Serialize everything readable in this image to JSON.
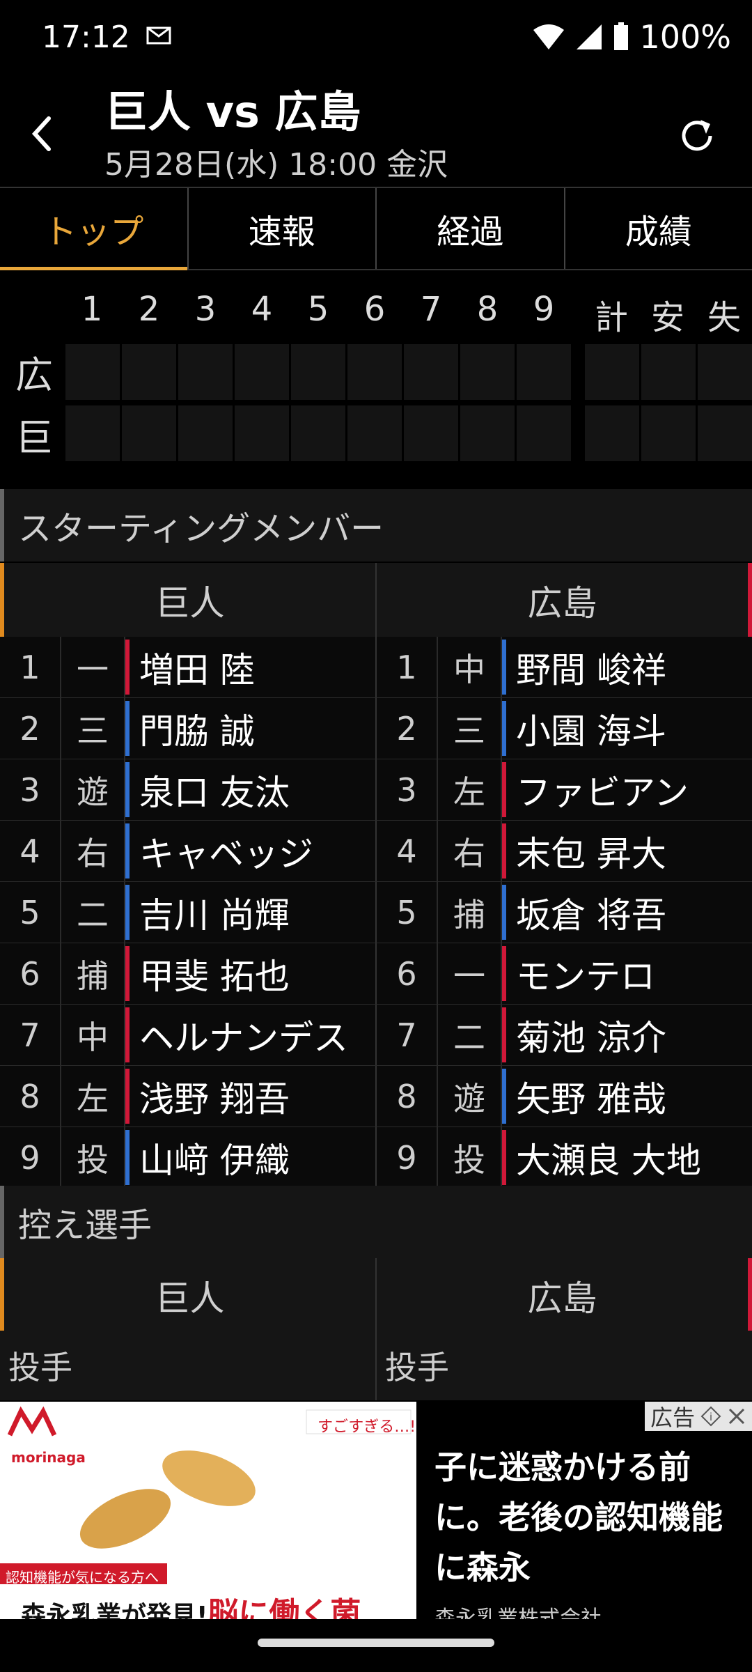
{
  "status": {
    "time": "17:12",
    "battery": "100%"
  },
  "header": {
    "title": "巨人 vs 広島",
    "subtitle": "5月28日(水) 18:00 金沢"
  },
  "tabs": [
    "トップ",
    "速報",
    "経過",
    "成績"
  ],
  "scoreboard": {
    "innings": [
      "1",
      "2",
      "3",
      "4",
      "5",
      "6",
      "7",
      "8",
      "9"
    ],
    "totals": [
      "計",
      "安",
      "失"
    ],
    "teams": [
      "広",
      "巨"
    ]
  },
  "starting": {
    "title": "スターティングメンバー",
    "home": "巨人",
    "away": "広島",
    "rows": [
      {
        "n": "1",
        "hp": "一",
        "hn": "増田 陸",
        "ap": "中",
        "an": "野間 峻祥"
      },
      {
        "n": "2",
        "hp": "三",
        "hn": "門脇 誠",
        "ap": "三",
        "an": "小園 海斗"
      },
      {
        "n": "3",
        "hp": "遊",
        "hn": "泉口 友汰",
        "ap": "左",
        "an": "ファビアン"
      },
      {
        "n": "4",
        "hp": "右",
        "hn": "キャベッジ",
        "ap": "右",
        "an": "末包 昇大"
      },
      {
        "n": "5",
        "hp": "二",
        "hn": "吉川 尚輝",
        "ap": "捕",
        "an": "坂倉 将吾"
      },
      {
        "n": "6",
        "hp": "捕",
        "hn": "甲斐 拓也",
        "ap": "一",
        "an": "モンテロ"
      },
      {
        "n": "7",
        "hp": "中",
        "hn": "ヘルナンデス",
        "ap": "二",
        "an": "菊池 涼介"
      },
      {
        "n": "8",
        "hp": "左",
        "hn": "浅野 翔吾",
        "ap": "遊",
        "an": "矢野 雅哉"
      },
      {
        "n": "9",
        "hp": "投",
        "hn": "山﨑 伊織",
        "ap": "投",
        "an": "大瀬良 大地"
      }
    ]
  },
  "bench": {
    "title": "控え選手",
    "home": "巨人",
    "away": "広島",
    "home_pitcher": "投手",
    "away_pitcher": "投手"
  },
  "ad": {
    "label": "広告",
    "brand": "morinaga",
    "tag": "すごすぎる…!",
    "caption": "認知機能が気になる方へ",
    "headline": "森永乳業が発見!",
    "headline_red": "脳に働く菌",
    "text": "子に迷惑かける前に。老後の認知機能に森永",
    "company": "森永乳業株式会社"
  },
  "colors": {
    "accent": "#e9a73a",
    "right_bat": "#d01838",
    "left_bat": "#2f6fd0"
  },
  "bat_sides": {
    "home": [
      "R",
      "L",
      "L",
      "L",
      "L",
      "R",
      "R",
      "R",
      "L"
    ],
    "away": [
      "L",
      "L",
      "R",
      "R",
      "L",
      "R",
      "R",
      "L",
      "R"
    ]
  }
}
